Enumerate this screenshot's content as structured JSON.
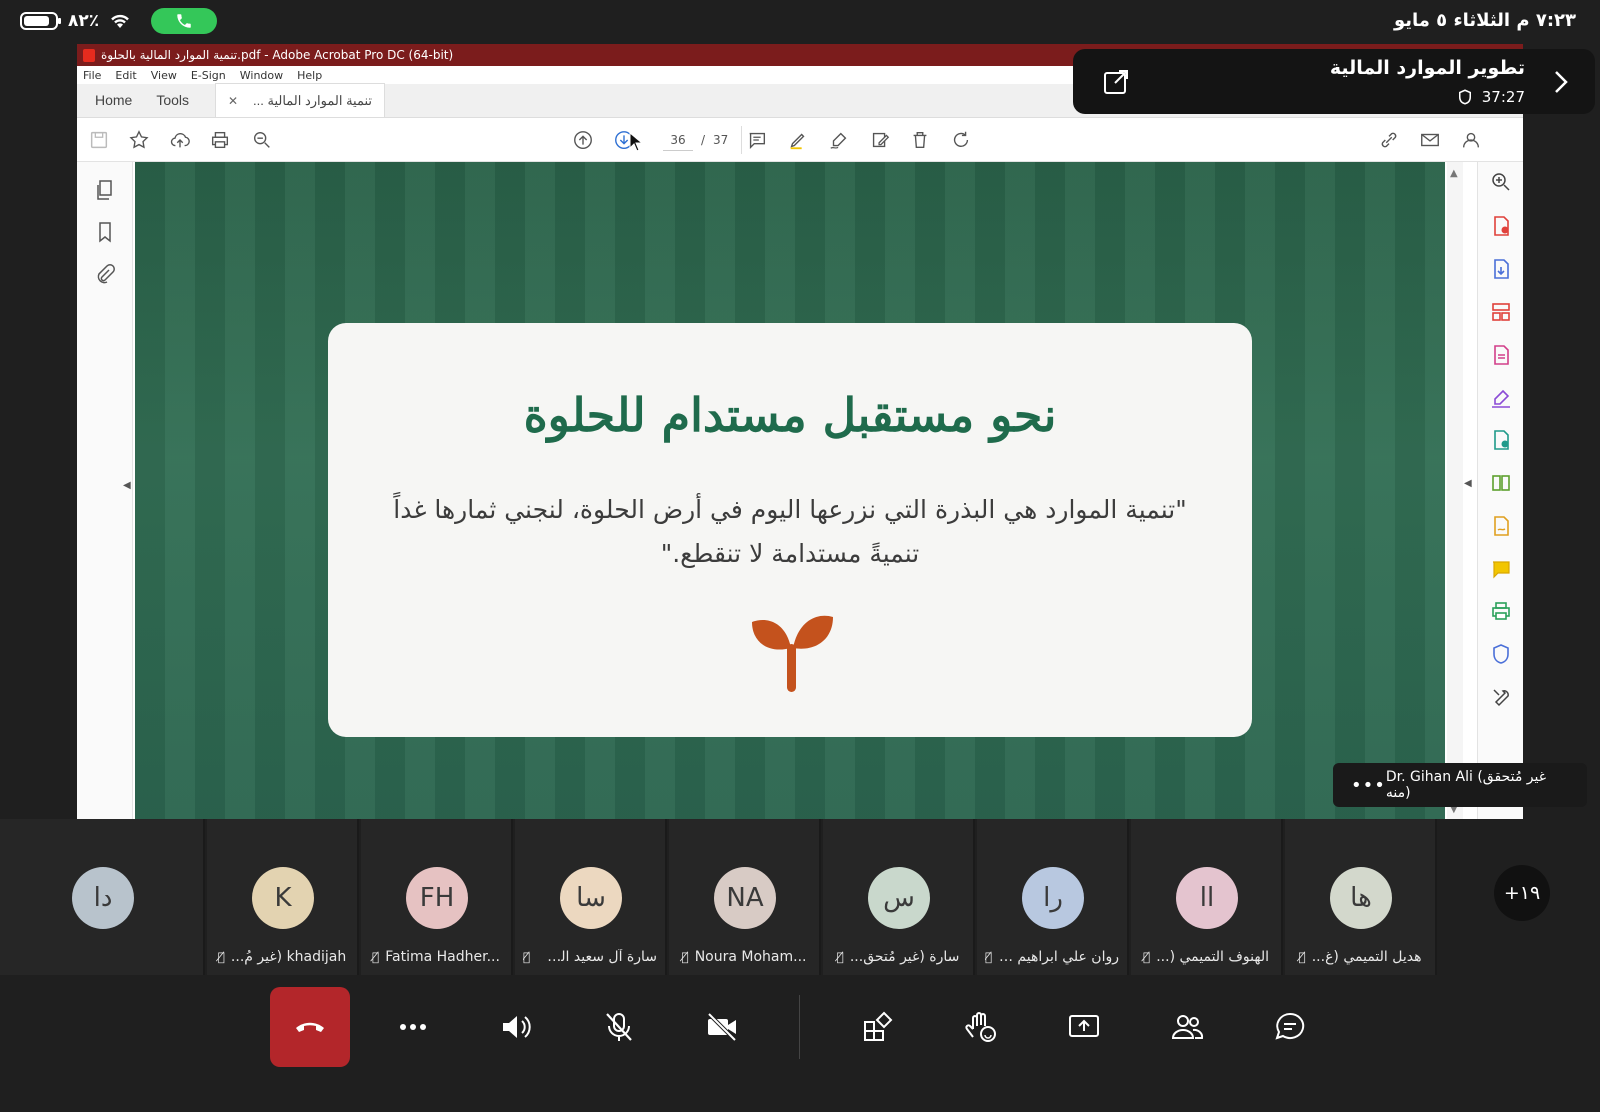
{
  "status_bar": {
    "battery": "٨٢٪",
    "datetime": "٧:٢٣ م  الثلاثاء ٥ مايو"
  },
  "acrobat": {
    "title": "تنمية الموارد المالية بالحلوة.pdf - Adobe Acrobat Pro DC (64-bit)",
    "menu": [
      "File",
      "Edit",
      "View",
      "E-Sign",
      "Window",
      "Help"
    ],
    "tabs": {
      "home": "Home",
      "tools": "Tools",
      "doc": "تنمية الموارد المالية ..."
    },
    "page": {
      "current": "36",
      "separator": "/",
      "total": "37"
    }
  },
  "slide": {
    "title": "نحو مستقبل مستدام للحلوة",
    "quote": "\"تنمية الموارد هي البذرة التي نزرعها اليوم في أرض الحلوة، لنجني ثمارها غداً تنميةً مستدامة لا تنقطع.\""
  },
  "meeting": {
    "title": "تطوير الموارد المالية",
    "timer": "37:27"
  },
  "presenter": {
    "name": "Dr. Gihan Ali (غير مُتحقق منه)"
  },
  "participants": [
    {
      "initials": "دا",
      "name": "",
      "color": "#b8c3cc"
    },
    {
      "initials": "K",
      "name": "khadijah  (غير مُ...",
      "color": "#e3d3b1"
    },
    {
      "initials": "FH",
      "name": "Fatima Hadher...",
      "color": "#e6c2c2"
    },
    {
      "initials": "سا",
      "name": "سارة آل سعيد الت...",
      "color": "#ecd8c0"
    },
    {
      "initials": "NA",
      "name": "Noura Moham...",
      "color": "#d8cbc5"
    },
    {
      "initials": "س",
      "name": "سارة  (غير مُتحق...",
      "color": "#c9d8cc"
    },
    {
      "initials": "را",
      "name": "روان علي ابراهيم ا...",
      "color": "#b8c8e0"
    },
    {
      "initials": "اا",
      "name": "الهنوف التميمي (...",
      "color": "#e4c4cf"
    },
    {
      "initials": "ها",
      "name": "هديل التميمي (غ...",
      "color": "#d3d8cc"
    }
  ],
  "more_participants": "+١٩"
}
